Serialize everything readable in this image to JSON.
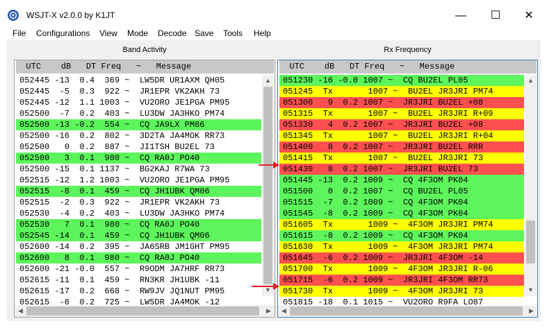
{
  "window": {
    "title": "WSJT-X   v2.0.0   by K1JT",
    "min_glyph": "—",
    "max_glyph": "☐",
    "close_glyph": "✕"
  },
  "menu": [
    "File",
    "Configurations",
    "View",
    "Mode",
    "Decode",
    "Save",
    "Tools",
    "Help"
  ],
  "band_activity": {
    "title": "Band Activity",
    "header": "  UTC    dB   DT Freq   ~   Message",
    "rows": [
      {
        "text": "052445 -13  0.4  369 ~  LW5DR UR1AXM QH05",
        "color": "#ffffff"
      },
      {
        "text": "052445  -5  0.3  922 ~  JR1EPR VK2AKH 73",
        "color": "#ffffff"
      },
      {
        "text": "052445 -12  1.1 1003 ~  VU2ORO JE1PGA PM95",
        "color": "#ffffff"
      },
      {
        "text": "052500  -7  0.2  403 ~  LU3DW JA3HKO PM74",
        "color": "#ffffff"
      },
      {
        "text": "052500 -13 -0.2  554 ~  CQ JA9LX PM86",
        "color": "#5cf55c"
      },
      {
        "text": "052500 -16  0.2  802 ~  3D2TA JA4MOK RR73",
        "color": "#ffffff"
      },
      {
        "text": "052500   0  0.2  887 ~  JI1TSH BU2EL 73",
        "color": "#ffffff"
      },
      {
        "text": "052500   3  0.1  980 ~  CQ RA0J PO40",
        "color": "#5cf55c"
      },
      {
        "text": "052500 -15  0.1 1137 ~  BG2KAJ R7WA 73",
        "color": "#ffffff"
      },
      {
        "text": "052515 -12  1.2 1003 ~  VU2ORO JE1PGA PM95",
        "color": "#ffffff"
      },
      {
        "text": "052515  -8  0.1  459 ~  CQ JH1UBK QM06",
        "color": "#5cf55c"
      },
      {
        "text": "052515  -2  0.3  922 ~  JR1EPR VK2AKH 73",
        "color": "#ffffff"
      },
      {
        "text": "052530  -4  0.2  403 ~  LU3DW JA3HKO PM74",
        "color": "#ffffff"
      },
      {
        "text": "052530   7  0.1  980 ~  CQ RA0J PO40",
        "color": "#5cf55c"
      },
      {
        "text": "052545 -14  0.1  459 ~  CQ JH1UBK QM06",
        "color": "#5cf55c"
      },
      {
        "text": "052600 -14  0.2  395 ~  JA6SRB JM1GHT PM95",
        "color": "#ffffff"
      },
      {
        "text": "052600   8  0.1  980 ~  CQ RA0J PO40",
        "color": "#5cf55c"
      },
      {
        "text": "052600 -21 -0.0  557 ~  R9ODM JA7HRF RR73",
        "color": "#ffffff"
      },
      {
        "text": "052615 -11  0.1  459 ~  RN3KR JH1UBK -11",
        "color": "#ffffff"
      },
      {
        "text": "052615 -17  0.2  668 ~  RW9JV JQ1NUT PM95",
        "color": "#ffffff"
      },
      {
        "text": "052615  -6  0.2  725 ~  LW5DR JA4MOK -12",
        "color": "#ffffff"
      }
    ]
  },
  "rx_frequency": {
    "title": "Rx Frequency",
    "header": "  UTC    dB   DT Freq   ~   Message",
    "rows": [
      {
        "text": "051230 -16 -0.0 1007 ~  CQ BU2EL PL05",
        "color": "#5cf55c"
      },
      {
        "text": "051245  Tx       1007 ~  BU2EL JR3JRI PM74",
        "color": "#ffff00"
      },
      {
        "text": "051300   9  0.2 1007 ~  JR3JRI BU2EL +08",
        "color": "#ff5050"
      },
      {
        "text": "051315  Tx       1007 ~  BU2EL JR3JRI R+09",
        "color": "#ffff00"
      },
      {
        "text": "051330   4  0.2 1007 ~  JR3JRI BU2EL +08",
        "color": "#ff5050"
      },
      {
        "text": "051345  Tx       1007 ~  BU2EL JR3JRI R+04",
        "color": "#ffff00"
      },
      {
        "text": "051400   8  0.2 1007 ~  JR3JRI BU2EL RRR",
        "color": "#ff5050"
      },
      {
        "text": "051415  Tx       1007 ~  BU2EL JR3JRI 73",
        "color": "#ffff00"
      },
      {
        "text": "051430   8  0.2 1007 ~  JR3JRI BU2EL 73",
        "color": "#ff5050"
      },
      {
        "text": "051445 -13  0.2 1009 ~  CQ 4F3OM PK04",
        "color": "#5cf55c"
      },
      {
        "text": "051500   0  0.2 1007 ~  CQ BU2EL PL05",
        "color": "#5cf55c"
      },
      {
        "text": "051515  -7  0.2 1009 ~  CQ 4F3OM PK04",
        "color": "#5cf55c"
      },
      {
        "text": "051545  -8  0.2 1009 ~  CQ 4F3OM PK04",
        "color": "#5cf55c"
      },
      {
        "text": "051605  Tx       1009 ~  4F3OM JR3JRI PM74",
        "color": "#ffff00"
      },
      {
        "text": "051615  -8  0.2 1009 ~  CQ 4F3OM PK04",
        "color": "#5cf55c"
      },
      {
        "text": "051630  Tx       1009 ~  4F3OM JR3JRI PM74",
        "color": "#ffff00"
      },
      {
        "text": "051645  -6  0.2 1009 ~  JR3JRI 4F3OM -14",
        "color": "#ff5050"
      },
      {
        "text": "051700  Tx       1009 ~  4F3OM JR3JRI R-06",
        "color": "#ffff00"
      },
      {
        "text": "051715  -6  0.2 1009 ~  JR3JRI 4F3OM RR73",
        "color": "#ff5050"
      },
      {
        "text": "051730  Tx       1009 ~  4F3OM JR3JRI 73",
        "color": "#ffff00"
      },
      {
        "text": "051815 -18  0.1 1015 ~  VU2ORO R9FA LO87",
        "color": "#ffffff"
      }
    ]
  },
  "scroll": {
    "up": "▲",
    "down": "▼",
    "left": "◀",
    "right": "▶"
  }
}
